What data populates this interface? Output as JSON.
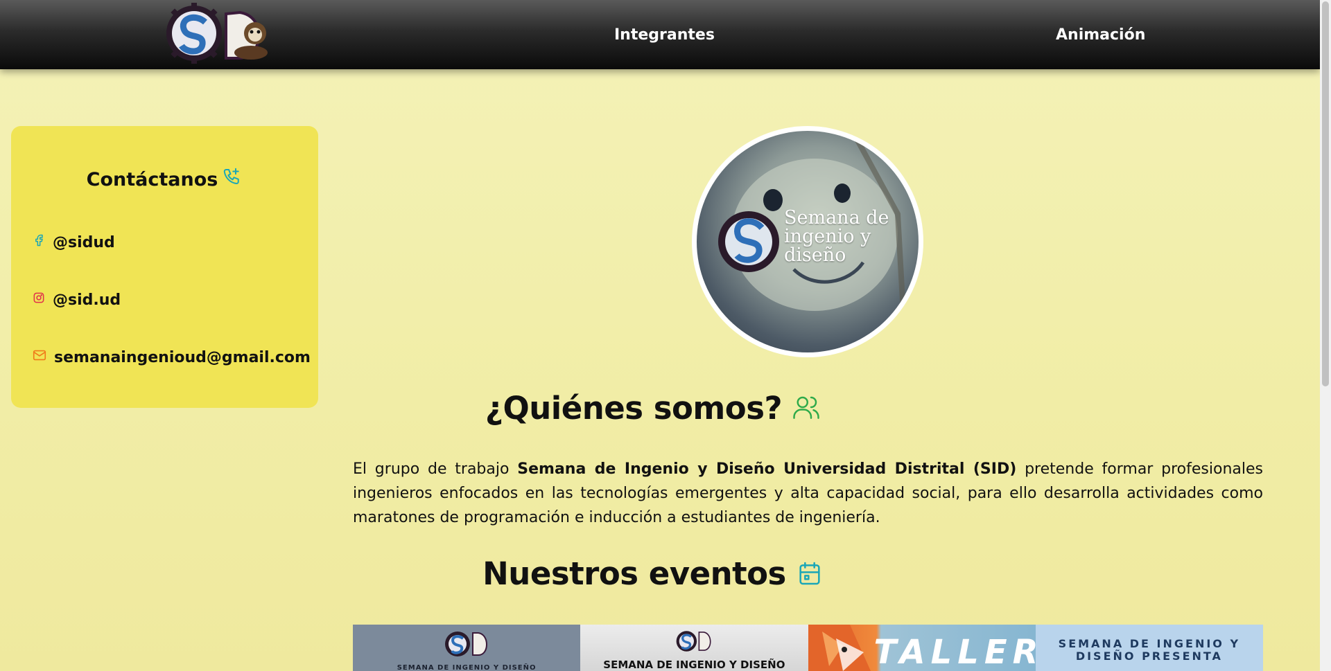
{
  "nav": {
    "links": [
      "Integrantes",
      "Animación"
    ]
  },
  "contact": {
    "title": "Contáctanos",
    "facebook": "@sidud",
    "instagram": "@sid.ud",
    "email": "semanaingenioud@gmail.com"
  },
  "profile": {
    "caption": [
      "Semana de",
      "ingenio y",
      "diseño"
    ]
  },
  "about": {
    "title": "¿Quiénes somos?",
    "text_before": "El grupo de trabajo ",
    "text_bold": "Semana de Ingenio y Diseño Universidad Distrital (SID)",
    "text_after": " pretende formar profesionales ingenieros enfocados en las tecnologías emergentes y alta capacidad social, para ello desarrolla actividades como maratones de programación e inducción a estudiantes de ingeniería."
  },
  "events": {
    "title": "Nuestros eventos",
    "cards": [
      "SEMANA DE INGENIO Y DISEÑO",
      "SEMANA DE INGENIO Y DISEÑO",
      "TALLER",
      "SEMANA DE INGENIO Y DISEÑO PRESENTA"
    ]
  },
  "colors": {
    "background": "#f3f0b0",
    "card": "#f0e455",
    "accent_icon": "#1aa6b7",
    "group_icon": "#2eaa4a",
    "navbar": "#111111"
  },
  "icons": [
    "sid-logo",
    "phone-plus-icon",
    "facebook-icon",
    "instagram-icon",
    "mail-icon",
    "users-icon",
    "calendar-icon"
  ]
}
